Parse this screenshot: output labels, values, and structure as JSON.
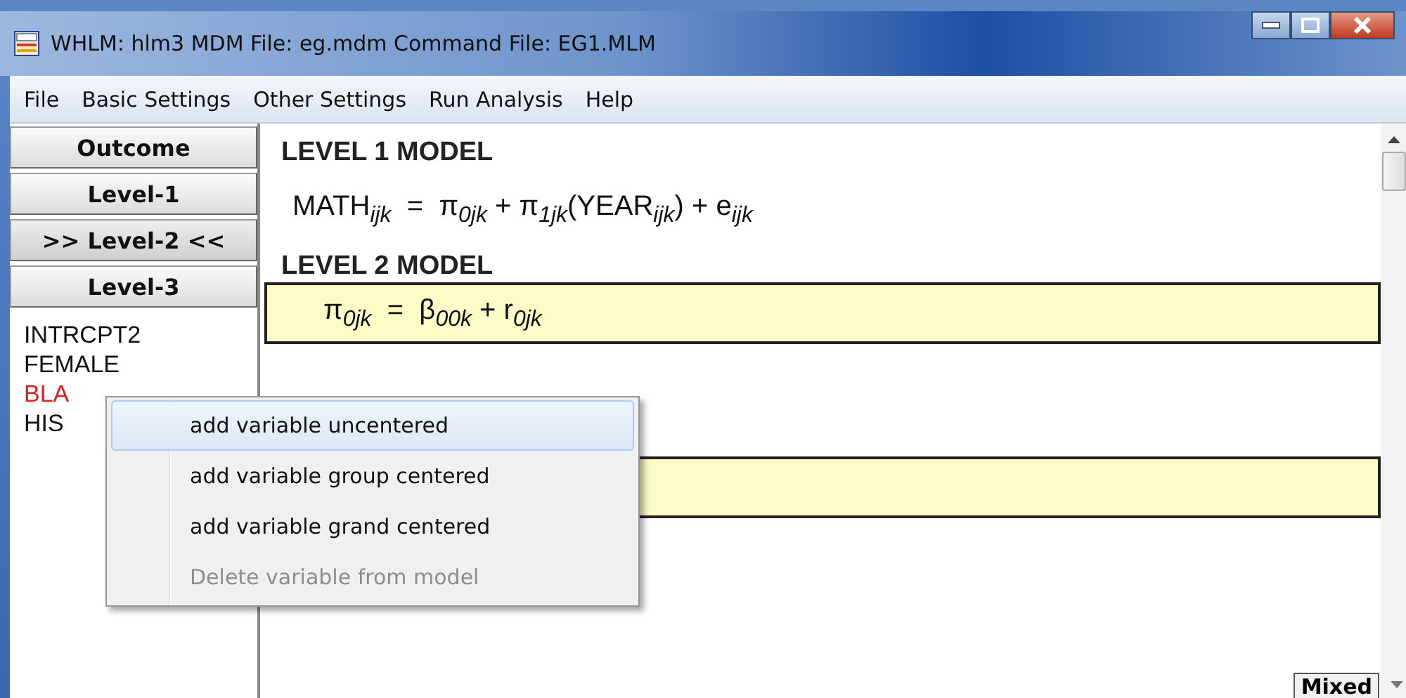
{
  "window": {
    "title": "WHLM: hlm3 MDM File: eg.mdm   Command File: EG1.MLM"
  },
  "menu": [
    "File",
    "Basic Settings",
    "Other Settings",
    "Run Analysis",
    "Help"
  ],
  "level_buttons": [
    {
      "label": "Outcome",
      "selected": false
    },
    {
      "label": "Level-1",
      "selected": false
    },
    {
      "label": ">> Level-2 <<",
      "selected": true
    },
    {
      "label": "Level-3",
      "selected": false
    }
  ],
  "variables": [
    {
      "name": "INTRCPT2",
      "selected": false
    },
    {
      "name": "FEMALE",
      "selected": false
    },
    {
      "name": "BLA",
      "selected": true
    },
    {
      "name": "HIS",
      "selected": false
    }
  ],
  "model": {
    "level1_heading": "LEVEL 1 MODEL",
    "level1_equation": "MATH$_{ijk}$  =  π$_{0jk}$ + π$_{1jk}$(YEAR$_{ijk}$) + e$_{ijk}$",
    "level2_heading": "LEVEL 2 MODEL",
    "level2_equation": "π$_{0jk}$  =  β$_{00k}$ + r$_{0jk}$"
  },
  "context_menu": [
    {
      "label": "add variable uncentered",
      "selected": true,
      "disabled": false
    },
    {
      "label": "add variable group centered",
      "selected": false,
      "disabled": false
    },
    {
      "label": "add variable grand centered",
      "selected": false,
      "disabled": false
    },
    {
      "label": "Delete variable from model",
      "selected": false,
      "disabled": true
    }
  ],
  "mode_button": "Mixed"
}
